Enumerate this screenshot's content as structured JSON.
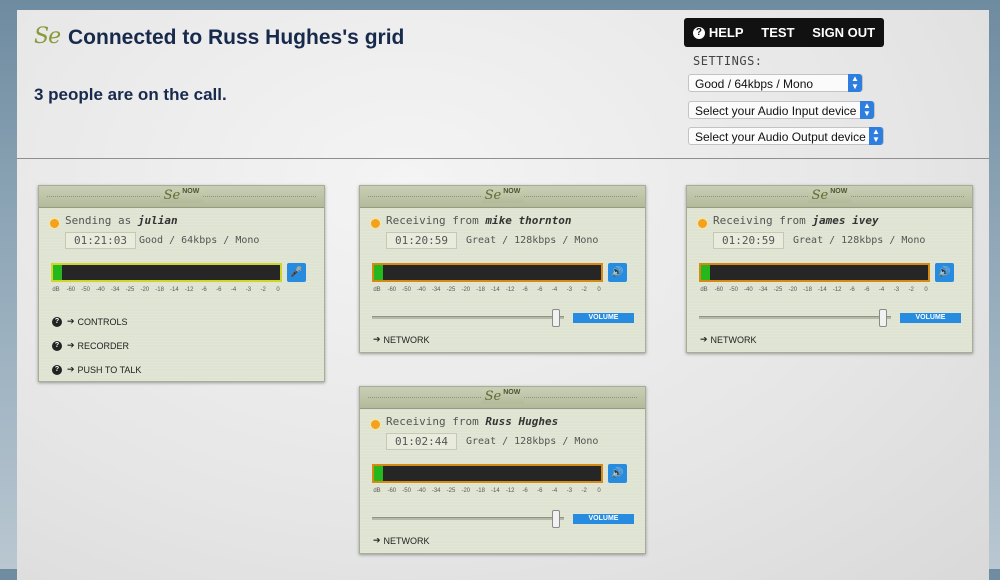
{
  "header": {
    "logo": "Se",
    "title": "Connected to Russ Hughes's grid",
    "people_count": "3 people are on the call."
  },
  "topbar": {
    "help": "HELP",
    "test": "TEST",
    "signout": "SIGN OUT"
  },
  "settings": {
    "label": "SETTINGS:",
    "quality": "Good / 64kbps / Mono",
    "audio_input": "Select your Audio Input device",
    "audio_output": "Select your Audio Output device"
  },
  "panel_common": {
    "logo": "Se",
    "now": "NOW",
    "ticks": [
      "dB",
      "-60",
      "-50",
      "-40",
      "-34",
      "-25",
      "-20",
      "-18",
      "-14",
      "-12",
      "-6",
      "-6",
      "-4",
      "-3",
      "-2",
      "0"
    ],
    "volume": "VOLUME",
    "network": "NETWORK"
  },
  "panels": [
    {
      "status_prefix": "Sending as",
      "name": "julian",
      "time": "01:21:03",
      "quality": "Good / 64kbps / Mono",
      "level": 0.04,
      "links": [
        "CONTROLS",
        "RECORDER",
        "PUSH TO TALK"
      ]
    },
    {
      "status_prefix": "Receiving from",
      "name": "mike thornton",
      "time": "01:20:59",
      "quality": "Great / 128kbps / Mono",
      "level": 0.04,
      "volume_level": 0.98
    },
    {
      "status_prefix": "Receiving from",
      "name": "james ivey",
      "time": "01:20:59",
      "quality": "Great / 128kbps / Mono",
      "level": 0.04,
      "volume_level": 0.98
    },
    {
      "status_prefix": "Receiving from",
      "name": "Russ Hughes",
      "time": "01:02:44",
      "quality": "Great / 128kbps / Mono",
      "level": 0.04,
      "volume_level": 0.98
    }
  ],
  "colors": {
    "title": "#182a4c",
    "accent_blue": "#278ce0",
    "status_orange": "#f4a11f",
    "meter_green": "#25b81c"
  }
}
